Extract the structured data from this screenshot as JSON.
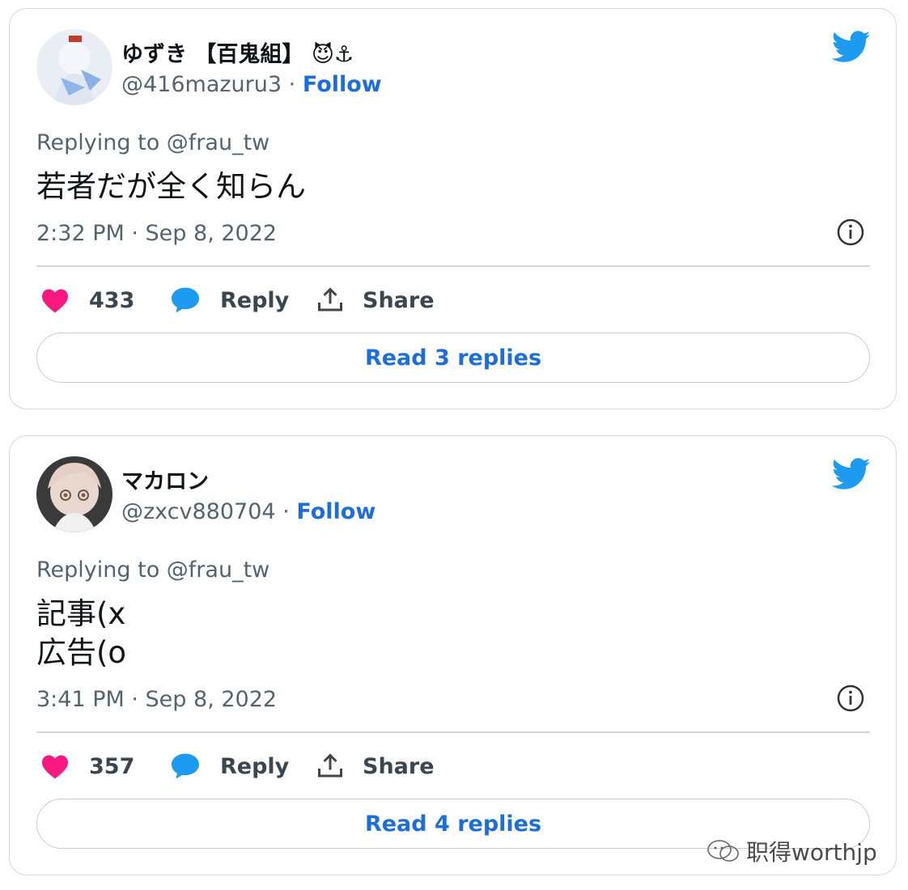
{
  "tweets": [
    {
      "display_name": "ゆずき 【百鬼組】",
      "name_emojis": "😈⚓",
      "handle": "@416mazuru3",
      "separator": "·",
      "follow_label": "Follow",
      "replying_to": "Replying to @frau_tw",
      "text": "若者だが全く知らん",
      "timestamp": "2:32 PM · Sep 8, 2022",
      "likes": "433",
      "reply_label": "Reply",
      "share_label": "Share",
      "read_replies": "Read 3 replies"
    },
    {
      "display_name": "マカロン",
      "handle": "@zxcv880704",
      "separator": "·",
      "follow_label": "Follow",
      "replying_to": "Replying to @frau_tw",
      "text_lines": [
        "記事(x",
        "広告(o"
      ],
      "timestamp": "3:41 PM · Sep 8, 2022",
      "likes": "357",
      "reply_label": "Reply",
      "share_label": "Share",
      "read_replies": "Read 4 replies"
    }
  ],
  "watermark": "职得worthjp",
  "colors": {
    "accent": "#1d6ed8",
    "twitter_blue": "#1d9bf0",
    "like": "#f91880",
    "border": "#cfd9de"
  },
  "icons": [
    "avatar",
    "twitter-bird-icon",
    "info-icon",
    "heart-icon",
    "comment-icon",
    "share-icon",
    "wechat-icon"
  ]
}
